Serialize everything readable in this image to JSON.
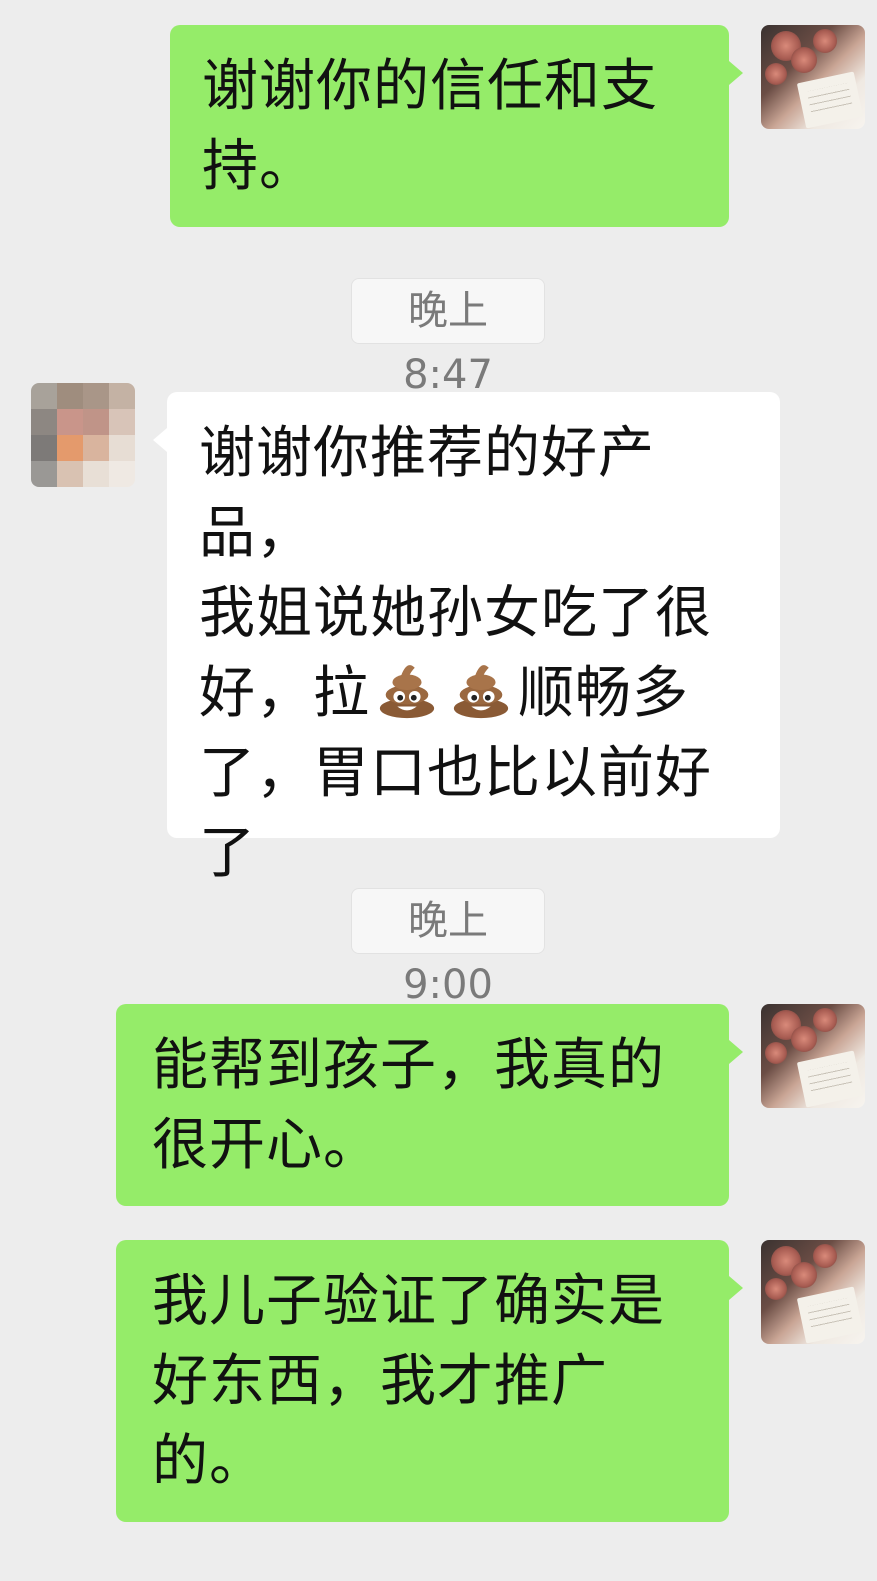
{
  "messages": [
    {
      "side": "me",
      "text": "谢谢你的信任和支持。"
    },
    {
      "time": "晚上8:47"
    },
    {
      "side": "them",
      "line1": "谢谢你推荐的好产品，",
      "line2": "我姐说她孙女吃了很",
      "line3_before": "好，拉",
      "line3_after": "顺畅多",
      "line4": "了，胃口也比以前好",
      "line5": "了"
    },
    {
      "time": "晚上9:00"
    },
    {
      "side": "me",
      "text": "能帮到孩子，我真的很开心。"
    },
    {
      "side": "me",
      "text": "我儿子验证了确实是好东西，我才推广的。"
    }
  ],
  "icons": {
    "avatar_me": "rose-bouquet-avatar",
    "avatar_them": "pixelated-avatar",
    "emoji": "poop-emoji"
  },
  "colors": {
    "bubble_me": "#95ec69",
    "bubble_them": "#ffffff",
    "background": "#ededed",
    "time_text": "#7a7a7a"
  }
}
